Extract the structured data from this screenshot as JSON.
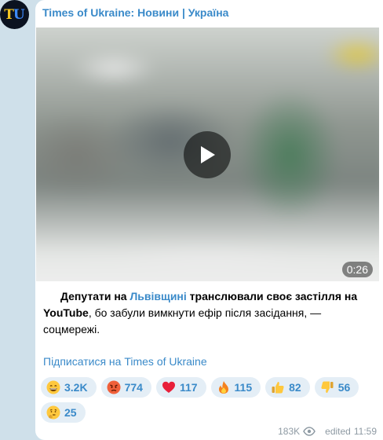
{
  "channel": {
    "avatar_letters": [
      "T",
      "U"
    ],
    "title": "Times of Ukraine: Новини | Україна"
  },
  "video": {
    "duration": "0:26"
  },
  "caption": {
    "part1": "Депутати на ",
    "link": "Львівщині",
    "part2": " транслювали своє застілля на ",
    "part3": "YouTube",
    "part4": ", бо забули вимкнути ефір після засідання, — соцмережі."
  },
  "subscribe_link": "Підписатися на Times of Ukraine",
  "reactions": [
    {
      "icon": "grin-emoji-icon",
      "count": "3.2K"
    },
    {
      "icon": "angry-emoji-icon",
      "count": "774"
    },
    {
      "icon": "heart-icon",
      "count": "117"
    },
    {
      "icon": "fire-icon",
      "count": "115"
    },
    {
      "icon": "thumbs-up-icon",
      "count": "82"
    },
    {
      "icon": "thumbs-down-icon",
      "count": "56"
    },
    {
      "icon": "thinking-emoji-icon",
      "count": "25"
    }
  ],
  "meta": {
    "views": "183K",
    "edited_label": "edited",
    "time": "11:59"
  },
  "colors": {
    "accent": "#3a8ac9",
    "background": "#cfe0ea",
    "reaction_bg": "#e4eef6"
  }
}
